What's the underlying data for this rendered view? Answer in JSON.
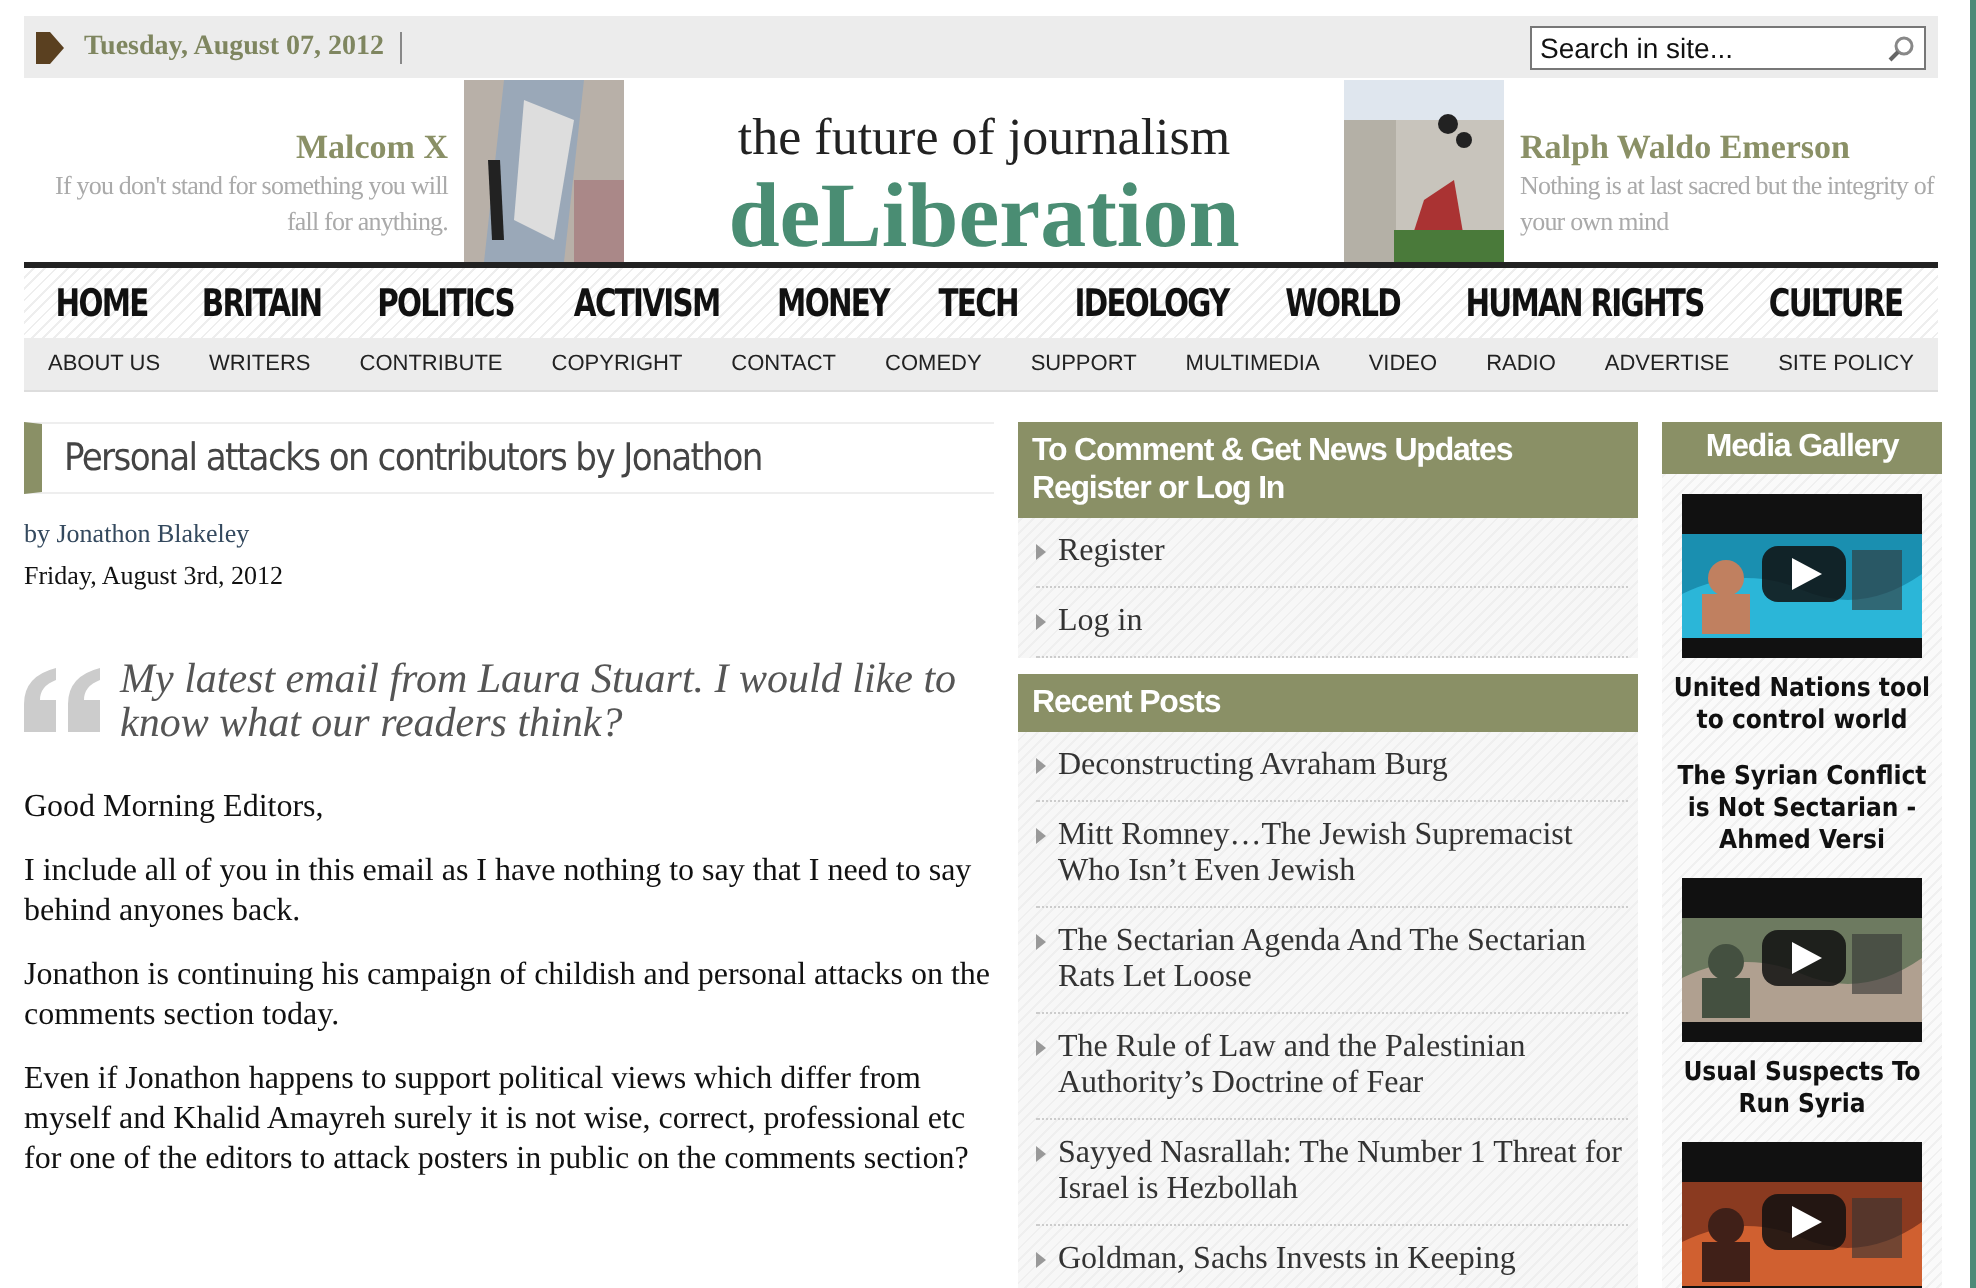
{
  "top_bar": {
    "date": "Tuesday, August 07, 2012",
    "search": {
      "placeholder": "Search in site..."
    }
  },
  "header": {
    "left_quote": {
      "author": "Malcom X",
      "text": "If you don't stand for something you will fall for anything."
    },
    "tagline": "the future of journalism",
    "logo": "deLiberation",
    "right_quote": {
      "author": "Ralph Waldo Emerson",
      "text": "Nothing is at last sacred but the integrity of your own mind"
    }
  },
  "main_nav": [
    "HOME",
    "BRITAIN",
    "POLITICS",
    "ACTIVISM",
    "MONEY",
    "TECH",
    "IDEOLOGY",
    "WORLD",
    "HUMAN RIGHTS",
    "CULTURE"
  ],
  "sub_nav": [
    "ABOUT US",
    "WRITERS",
    "CONTRIBUTE",
    "COPYRIGHT",
    "CONTACT",
    "COMEDY",
    "SUPPORT",
    "MULTIMEDIA",
    "VIDEO",
    "RADIO",
    "ADVERTISE",
    "SITE POLICY"
  ],
  "article": {
    "title": "Personal attacks on contributors by Jonathon",
    "byline": "by Jonathon Blakeley",
    "date": "Friday, August 3rd, 2012",
    "pullquote": "My latest email from Laura Stuart. I would like to know what our readers think?",
    "paragraphs": [
      "Good Morning Editors,",
      "I include all of you in this email as I have nothing to say that I need to say behind anyones back.",
      "Jonathon is continuing his campaign of childish and personal attacks on the comments section today.",
      "Even if Jonathon happens to support political views which differ from myself and Khalid Amayreh surely it is not wise, correct, professional etc for one of the editors to attack posters in public on the comments section?"
    ]
  },
  "sidebar": {
    "widgets": [
      {
        "title": "To Comment & Get News Updates Register or Log In",
        "items": [
          "Register",
          "Log in"
        ]
      },
      {
        "title": "Recent Posts",
        "items": [
          "Deconstructing Avraham Burg",
          "Mitt Romney…The Jewish Supremacist Who Isn’t Even Jewish",
          "The Sectarian Agenda And The Sectarian Rats Let Loose",
          "The Rule of Law and the Palestinian Authority’s Doctrine of Fear",
          "Sayyed Nasrallah: The Number 1 Threat for Israel is Hezbollah",
          "Goldman, Sachs Invests in Keeping"
        ]
      }
    ]
  },
  "media_gallery": {
    "title": "Media Gallery",
    "items": [
      {
        "kind": "video",
        "captions": [
          "United Nations tool to control world",
          "The Syrian Conflict is Not Sectarian - Ahmed Versi"
        ]
      },
      {
        "kind": "video",
        "captions": [
          "Usual Suspects To Run Syria"
        ]
      },
      {
        "kind": "video"
      }
    ]
  }
}
